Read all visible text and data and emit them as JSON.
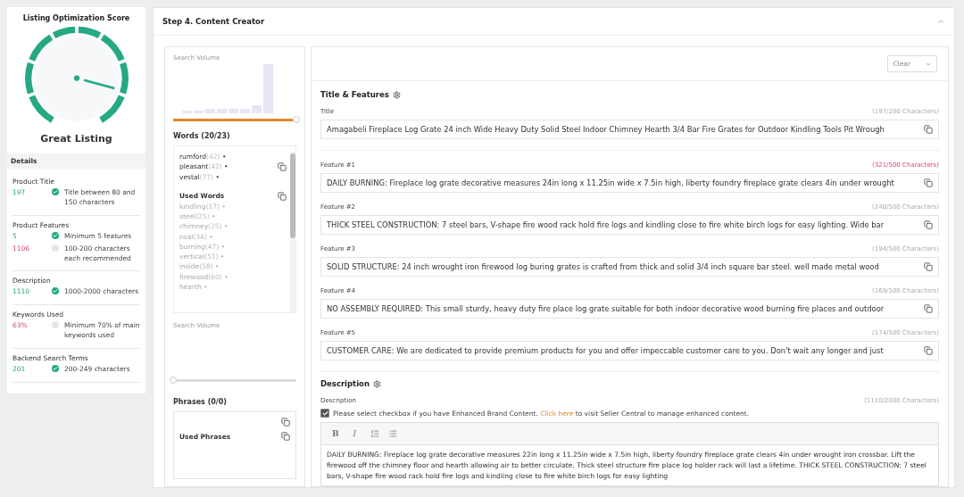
{
  "score_panel": {
    "title": "Listing Optimization Score",
    "verdict": "Great Listing"
  },
  "details": {
    "heading": "Details",
    "groups": [
      {
        "title": "Product Title",
        "checks": [
          {
            "value": "197",
            "met": true,
            "text": "Title between 80 and 150 characters"
          }
        ]
      },
      {
        "title": "Product Features",
        "checks": [
          {
            "value": "5",
            "met": true,
            "text": "Minimum 5 features"
          },
          {
            "value": "1106",
            "met": false,
            "text": "100-200 characters each recommended"
          }
        ]
      },
      {
        "title": "Description",
        "checks": [
          {
            "value": "1110",
            "met": true,
            "text": "1000-2000 characters"
          }
        ]
      },
      {
        "title": "Keywords Used",
        "checks": [
          {
            "value": "63%",
            "met": false,
            "text": "Minimum 70% of main keywords used"
          }
        ]
      },
      {
        "title": "Backend Search Terms",
        "checks": [
          {
            "value": "201",
            "met": true,
            "text": "200-249 characters"
          }
        ]
      }
    ]
  },
  "step": {
    "title": "Step 4. Content Creator",
    "expanded": true
  },
  "words_panel": {
    "search_volume_label": "Search Volume",
    "volume_slider": {
      "level": 1
    },
    "words_title": "Words (20/23)",
    "words": [
      {
        "word": "rumford",
        "count": "(42)"
      },
      {
        "word": "pleasant",
        "count": "(42)"
      },
      {
        "word": "vestal",
        "count": "(77)"
      }
    ],
    "used_title": "Used Words",
    "used_words": [
      {
        "word": "kindling",
        "count": "(17)"
      },
      {
        "word": "steel",
        "count": "(25)"
      },
      {
        "word": "chimney",
        "count": "(25)"
      },
      {
        "word": "coal",
        "count": "(34)"
      },
      {
        "word": "burning",
        "count": "(47)"
      },
      {
        "word": "vertical",
        "count": "(51)"
      },
      {
        "word": "inside",
        "count": "(58)"
      },
      {
        "word": "firewood",
        "count": "(60)"
      },
      {
        "word": "hearth"
      }
    ],
    "bullet": "•",
    "phrase_volume_label": "Search Volume",
    "phrase_slider": {
      "level": 0
    },
    "phrases_title": "Phrases (0/0)",
    "used_phrases_title": "Used Phrases"
  },
  "editor": {
    "clear_select": "Clear",
    "title_features_heading": "Title & Features",
    "fields": [
      {
        "label": "Title",
        "count": "(197/200 Characters)",
        "warning": false,
        "value": "Amagabeli Fireplace Log Grate 24 inch Wide Heavy Duty Solid Steel Indoor Chimney Hearth 3/4 Bar Fire Grates for Outdoor Kindling Tools Pit Wrough"
      },
      {
        "label": "Feature #1",
        "count": "(321/500 Characters)",
        "warning": true,
        "value": "DAILY BURNING: Fireplace log grate decorative measures 24in long x 11.25in wide x 7.5in high, liberty foundry fireplace grate clears 4in under wrought"
      },
      {
        "label": "Feature #2",
        "count": "(248/500 Characters)",
        "warning": false,
        "value": "THICK STEEL CONSTRUCTION: 7 steel bars, V-shape fire wood rack hold fire logs and kindling close to fire white birch logs for easy lighting. Wide bar"
      },
      {
        "label": "Feature #3",
        "count": "(194/500 Characters)",
        "warning": false,
        "value": "SOLID STRUCTURE: 24 inch wrought iron firewood log buring grates is crafted from thick and solid 3/4 inch square bar steel. well made metal wood"
      },
      {
        "label": "Feature #4",
        "count": "(169/500 Characters)",
        "warning": false,
        "value": "NO ASSEMBLY REQUIRED: This small sturdy, heavy duty fire place log grate suitable for both indoor decorative wood burning fire places and outdoor"
      },
      {
        "label": "Feature #5",
        "count": "(174/500 Characters)",
        "warning": false,
        "value": "CUSTOMER CARE: We are dedicated to provide premium products for you and offer impeccable customer care to you. Don't wait any longer and just"
      }
    ],
    "description_heading": "Description",
    "description_label": "Description",
    "description_count": "(1110/2000 Characters)",
    "ebc": {
      "checked": true,
      "before": "Please select checkbox if you have Enhanced Brand Content.",
      "link": "Click here",
      "after": "to visit Seller Central to manage enhanced content."
    },
    "toolbar": [
      "B",
      "I"
    ],
    "description_text": "DAILY BURNING: Fireplace log grate decorative measures 22in long x 11.25in wide x 7.5in high, liberty foundry fireplace grate clears 4in under wrought iron crossbar. Lift the firewood off the chimney floor and hearth allowing air to better circulate. Thick steel structure fire place log holder rack will last a lifetime. THICK STEEL CONSTRUCTION: 7 steel bars, V-shape fire wood rack hold fire logs and kindling close to fire white birch logs for easy lighting"
  }
}
